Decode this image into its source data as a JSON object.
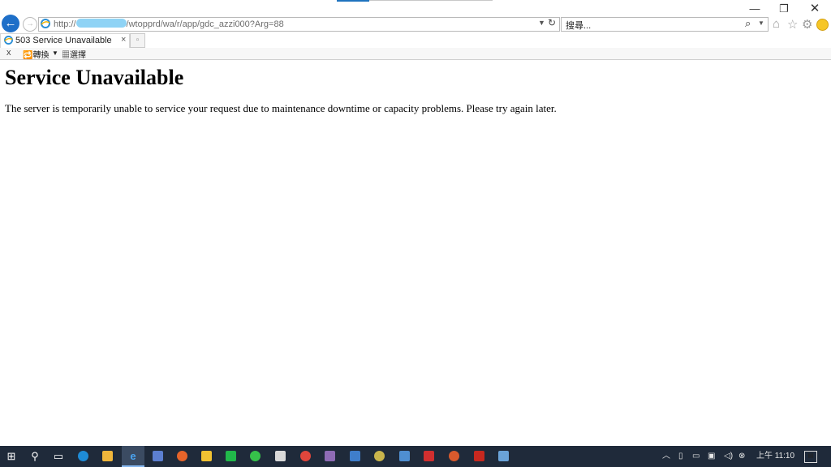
{
  "window": {
    "minimize": "—",
    "maximize": "❐",
    "close": "✕"
  },
  "nav": {
    "back": "←",
    "forward": "→",
    "address_scheme": "http://",
    "address_path": "/wtopprd/wa/r/app/gdc_azzi000?Arg=88",
    "search_placeholder": "搜尋...",
    "search_icon": "⚲",
    "refresh_icon": "↻"
  },
  "tabs": [
    {
      "label": "503 Service Unavailable",
      "close": "×"
    }
  ],
  "commandbar": {
    "close": "x",
    "translate_label": "轉換",
    "select_label": "選擇"
  },
  "page": {
    "heading": "Service Unavailable",
    "message": "The server is temporarily unable to service your request due to maintenance downtime or capacity problems. Please try again later."
  },
  "taskbar": {
    "clock": "上午 11:10",
    "apps": [
      "start-icon",
      "search-icon",
      "task-view-icon",
      "edge-icon",
      "file-explorer-icon",
      "ie-icon",
      "app-icon",
      "firefox-icon",
      "app-icon",
      "line-icon",
      "wechat-icon",
      "app-icon",
      "chrome-icon",
      "app-icon",
      "app-icon",
      "app-icon",
      "app-icon",
      "acrobat-icon",
      "app-icon",
      "filezilla-icon",
      "app-icon"
    ]
  },
  "colors": {
    "accent": "#1e6fc8",
    "taskbar": "#1f2a3a",
    "url_mask": "#8fd3f5"
  }
}
